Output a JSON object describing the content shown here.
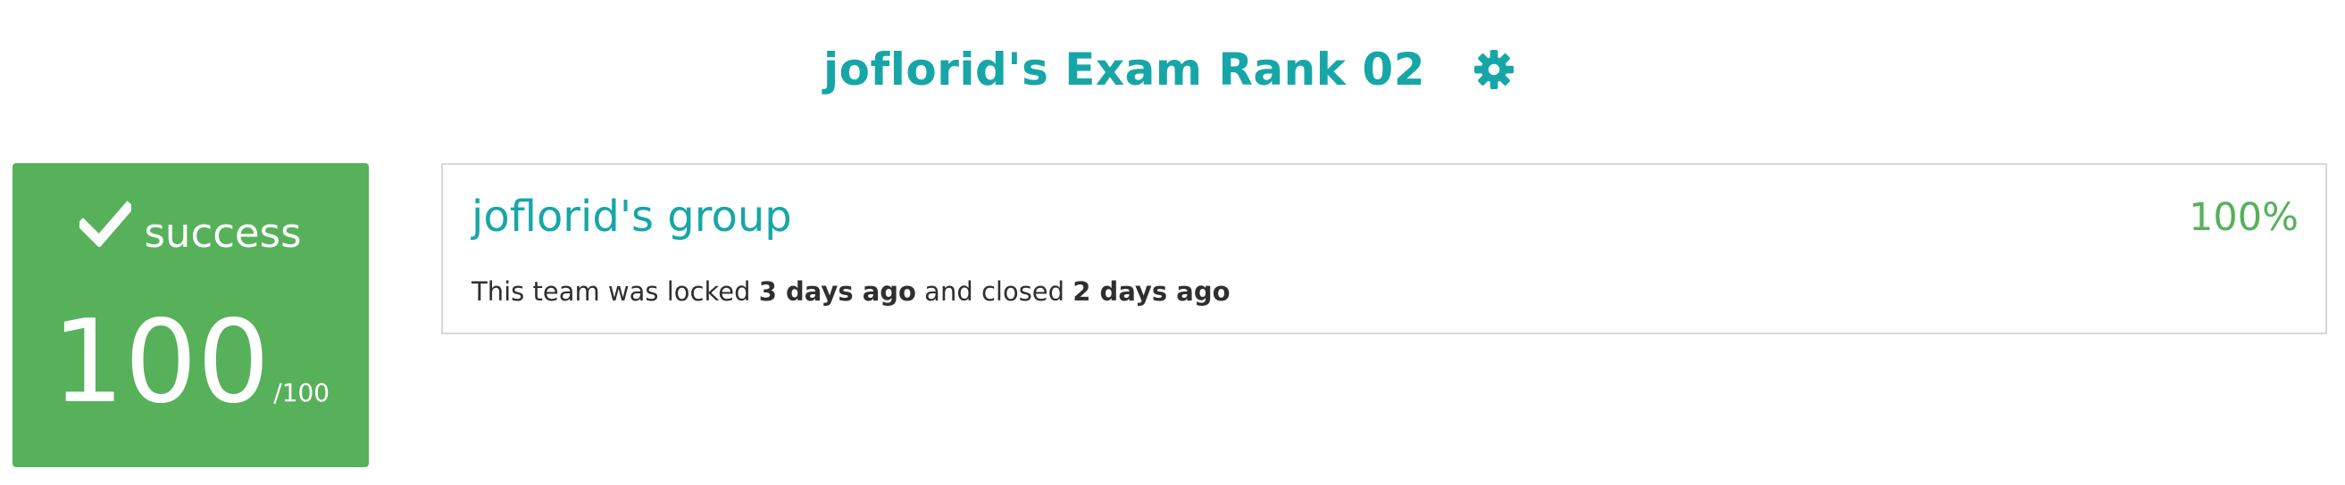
{
  "header": {
    "title": "joflorid's Exam Rank 02",
    "settings_icon": "gear-icon"
  },
  "score_card": {
    "status_icon": "check-icon",
    "status": "success",
    "score": "100",
    "total": "/100",
    "color": "#56b15a"
  },
  "team": {
    "name": "joflorid's group",
    "grade": "100%",
    "status_prefix": "This team was locked ",
    "locked": "3 days ago",
    "status_middle": " and closed ",
    "closed": "2 days ago"
  },
  "colors": {
    "accent": "#17a6a8",
    "success": "#56b15a",
    "text": "#2f2f2f",
    "border": "#d7d7d7"
  }
}
